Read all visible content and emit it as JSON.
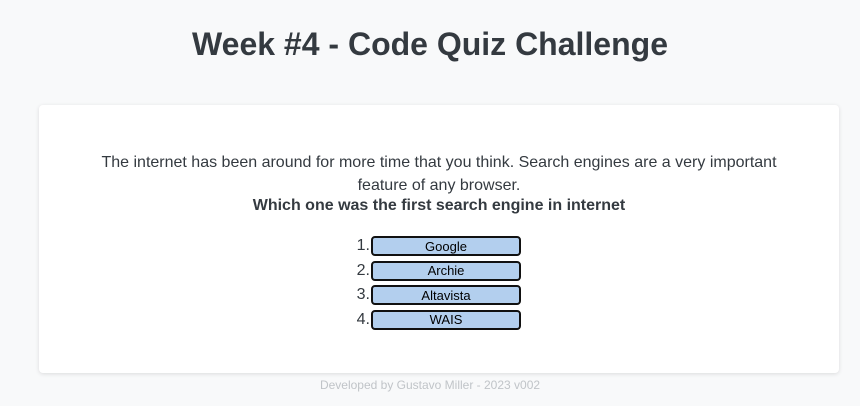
{
  "header": {
    "title": "Week #4 - Code Quiz Challenge"
  },
  "quiz": {
    "intro": "The internet has been around for more time that you think. Search engines are a very important feature of any browser.",
    "question": "Which one was the first search engine in internet",
    "answers": [
      {
        "number": "1.",
        "label": "Google"
      },
      {
        "number": "2.",
        "label": "Archie"
      },
      {
        "number": "3.",
        "label": "Altavista"
      },
      {
        "number": "4.",
        "label": "WAIS"
      }
    ]
  },
  "footer": {
    "text": "Developed by Gustavo Miller - 2023 v002"
  },
  "colors": {
    "background": "#f8f9fa",
    "card": "#ffffff",
    "answer_button": "#b3cfee",
    "answer_border": "#111111",
    "text": "#343a40",
    "footer_text": "#c0c4c8"
  }
}
